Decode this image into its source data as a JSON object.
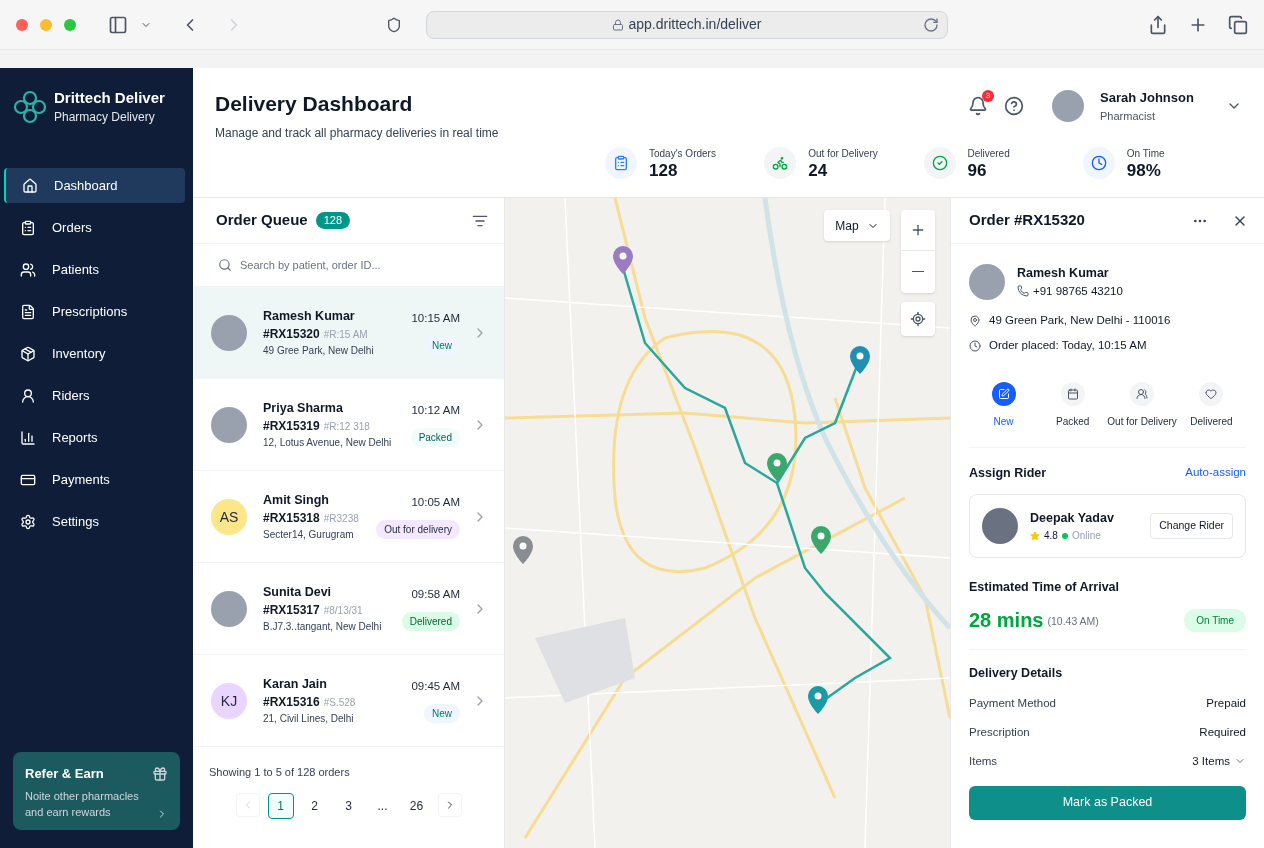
{
  "browser": {
    "url": "app.drittech.in/deliver"
  },
  "brand": {
    "name": "Drittech Deliver",
    "tagline": "Pharmacy Delivery"
  },
  "sidebar": {
    "items": [
      {
        "label": "Dashboard",
        "selected": true
      },
      {
        "label": "Orders",
        "selected": false
      },
      {
        "label": "Patients",
        "selected": false
      },
      {
        "label": "Prescriptions",
        "selected": false
      },
      {
        "label": "Inventory",
        "selected": false
      },
      {
        "label": "Riders",
        "selected": false
      },
      {
        "label": "Reports",
        "selected": false
      },
      {
        "label": "Payments",
        "selected": false
      },
      {
        "label": "Settings",
        "selected": false
      }
    ],
    "promo": {
      "title": "Refer & Earn",
      "text": "Noite other pharmacles and earn rewards"
    }
  },
  "header": {
    "title": "Delivery Dashboard",
    "subtitle": "Manage and track all pharmacy deliveries in real time",
    "notifications": "3",
    "user": {
      "name": "Sarah Johnson",
      "role": "Pharmacist"
    }
  },
  "stats": [
    {
      "kind": "orders",
      "label": "Today's Orders",
      "value": "128"
    },
    {
      "kind": "scooter",
      "label": "Out for Delivery",
      "value": "24"
    },
    {
      "kind": "check",
      "label": "Delivered",
      "value": "96"
    },
    {
      "kind": "clock",
      "label": "On Time",
      "value": "98%"
    }
  ],
  "queue": {
    "title": "Order Queue",
    "count": "128",
    "search": {
      "placeholder": "Search by patient, order ID..."
    },
    "orders": [
      {
        "name": "Ramesh Kumar",
        "id": "#RX15320",
        "sub": "#R:15 AM",
        "address": "49 Gree Park, New Delhi",
        "time": "10:15 AM",
        "status": "New",
        "kind": "new",
        "selected": true
      },
      {
        "name": "Priya Sharma",
        "id": "#RX15319",
        "sub": "#R:12 318",
        "address": "12, Lotus Avenue, New Delhi",
        "time": "10:12 AM",
        "status": "Packed",
        "kind": "packed",
        "selected": false
      },
      {
        "name": "Amit Singh",
        "id": "#RX15318",
        "sub": "#R3238",
        "address": "Secter14, Gurugram",
        "time": "10:05 AM",
        "status": "Out for delivery",
        "kind": "out",
        "initials": "AS",
        "color": "#fde68a",
        "selected": false
      },
      {
        "name": "Sunita Devi",
        "id": "#RX15317",
        "sub": "#8/13/31",
        "address": "B.J7.3..tangant, New Delhi",
        "time": "09:58 AM",
        "status": "Delivered",
        "kind": "delivered",
        "selected": false
      },
      {
        "name": "Karan Jain",
        "id": "#RX15316",
        "sub": "#S.528",
        "address": "21, Civil Lines, Delhi",
        "time": "09:45 AM",
        "status": "New",
        "kind": "new",
        "initials": "KJ",
        "color": "#e9d5ff",
        "selected": false
      }
    ],
    "summary": "Showing 1 to 5 of 128 orders",
    "pages": [
      {
        "label": "1",
        "selected": true
      },
      {
        "label": "2",
        "selected": false
      },
      {
        "label": "3",
        "selected": false
      },
      {
        "label": "...",
        "selected": false
      },
      {
        "label": "26",
        "selected": false
      }
    ]
  },
  "map": {
    "view": "Map"
  },
  "detail": {
    "title": "Order #RX15320",
    "patient": {
      "name": "Ramesh Kumar",
      "phone": "+91 98765 43210",
      "address": "49 Green Park, New Delhi - 110016",
      "placed": "Order placed: Today, 10:15 AM"
    },
    "steps": [
      {
        "label": "New",
        "selected": true
      },
      {
        "label": "Packed",
        "selected": false
      },
      {
        "label": "Out for Delivery",
        "selected": false
      },
      {
        "label": "Delivered",
        "selected": false
      }
    ],
    "rider": {
      "heading": "Assign Rider",
      "auto": "Auto-assign",
      "name": "Deepak Yadav",
      "rating": "4.8",
      "status": "Online",
      "online": true,
      "change": "Change Rider"
    },
    "eta": {
      "heading": "Estimated Time of Arrival",
      "value": "28 mins",
      "time": "(10.43 AM)",
      "badge": "On Time"
    },
    "details": {
      "heading": "Delivery Details",
      "rows": [
        {
          "label": "Payment Method",
          "value": "Prepaid",
          "kind": "text"
        },
        {
          "label": "Prescription",
          "value": "Required",
          "kind": "text"
        },
        {
          "label": "Items",
          "value": "3 Items",
          "kind": "dropdown"
        }
      ]
    },
    "action": "Mark as Packed"
  }
}
